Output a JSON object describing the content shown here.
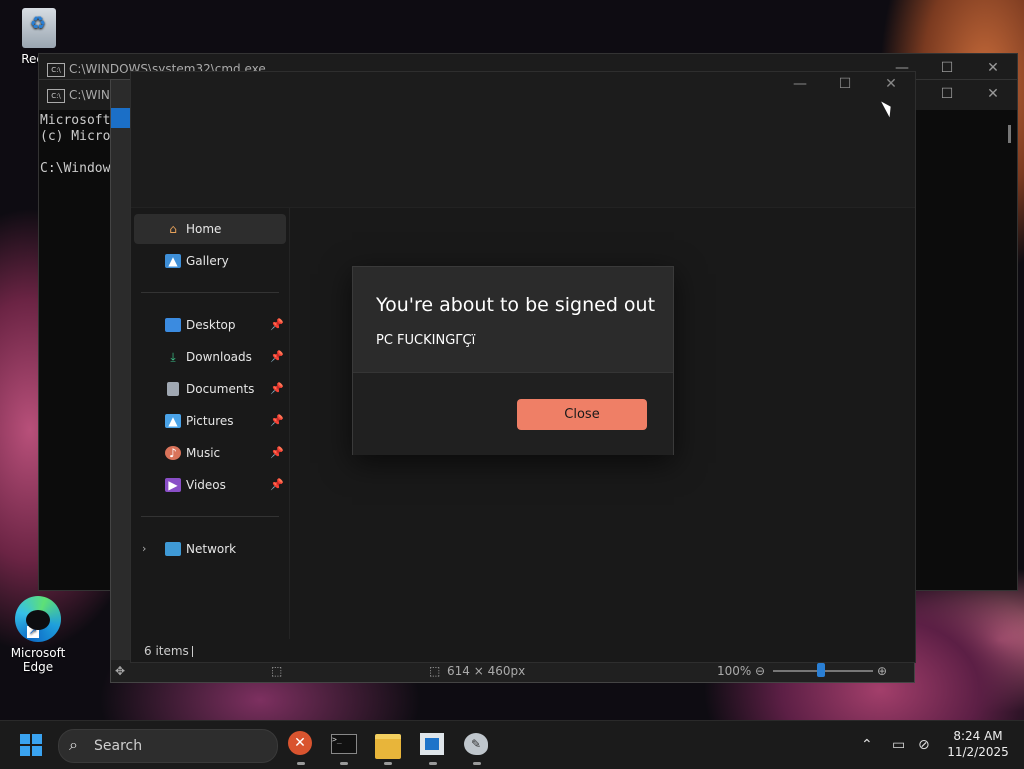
{
  "desktop": {
    "icons": [
      {
        "label": "Recyc"
      },
      {
        "label": "Microsoft Edge"
      }
    ]
  },
  "cmd_windows": [
    {
      "title": "C:\\WINDOWS\\system32\\cmd.exe"
    },
    {
      "title": "C:\\WINI",
      "lines": [
        "Microsoft",
        "(c) Micro",
        "",
        "C:\\Window"
      ]
    }
  ],
  "window_controls": {
    "minimize": "—",
    "maximize": "☐",
    "close": "✕"
  },
  "explorer": {
    "nav": [
      {
        "label": "Home",
        "icon": "home-icon"
      },
      {
        "label": "Gallery",
        "icon": "gallery-icon"
      }
    ],
    "pinned": [
      {
        "label": "Desktop",
        "icon": "desktop-icon"
      },
      {
        "label": "Downloads",
        "icon": "downloads-icon"
      },
      {
        "label": "Documents",
        "icon": "documents-icon"
      },
      {
        "label": "Pictures",
        "icon": "pictures-icon"
      },
      {
        "label": "Music",
        "icon": "music-icon"
      },
      {
        "label": "Videos",
        "icon": "videos-icon"
      }
    ],
    "network": {
      "label": "Network",
      "icon": "network-icon"
    },
    "status_items": "6 items"
  },
  "paint": {
    "status_size": "614 × 460px",
    "zoom": "100%"
  },
  "dialog": {
    "heading": "You're about to be signed out",
    "message": "PC FUCKINGΓÇï",
    "close_label": "Close",
    "accent": "#ef7f66"
  },
  "taskbar": {
    "search_placeholder": "Search",
    "clock_time": "8:24 AM",
    "clock_date": "11/2/2025"
  }
}
